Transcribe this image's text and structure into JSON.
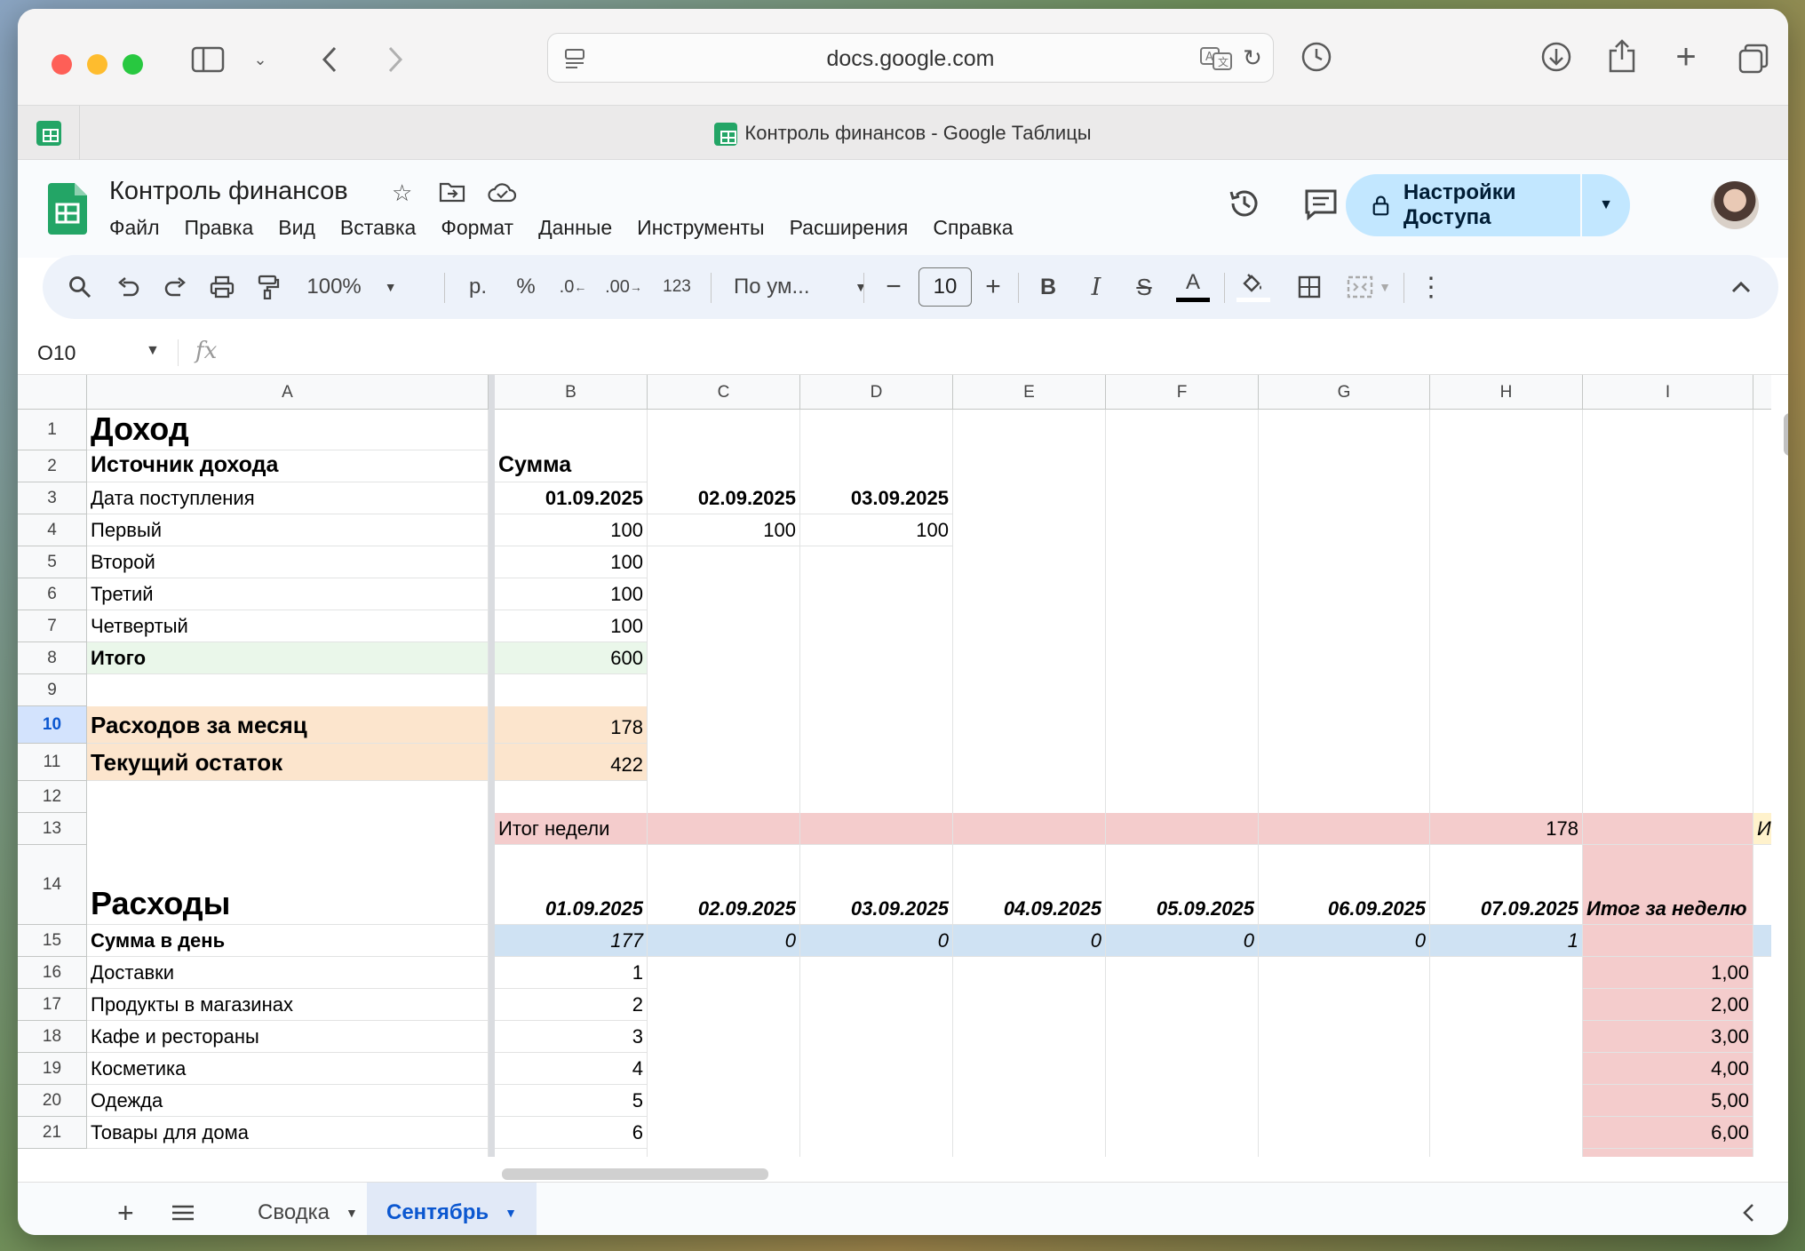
{
  "browser": {
    "url": "docs.google.com",
    "tab_title": "Контроль финансов - Google Таблицы"
  },
  "doc": {
    "title": "Контроль финансов",
    "menu": [
      "Файл",
      "Правка",
      "Вид",
      "Вставка",
      "Формат",
      "Данные",
      "Инструменты",
      "Расширения",
      "Справка"
    ],
    "share_label": "Настройки Доступа"
  },
  "toolbar": {
    "zoom": "100%",
    "currency": "р.",
    "percent": "%",
    "dec_decrease": ".0",
    "dec_increase": ".00",
    "number_format": "123",
    "font": "По ум...",
    "font_size": "10"
  },
  "formula": {
    "cell_ref": "O10",
    "fx": "fx"
  },
  "columns": [
    "A",
    "B",
    "C",
    "D",
    "E",
    "F",
    "G",
    "H",
    "I"
  ],
  "rows": [
    "1",
    "2",
    "3",
    "4",
    "5",
    "6",
    "7",
    "8",
    "9",
    "10",
    "11",
    "12",
    "13",
    "14",
    "15",
    "16",
    "17",
    "18",
    "19",
    "20",
    "21"
  ],
  "cells": {
    "A1": "Доход",
    "A2": "Источник дохода",
    "B2": "Сумма",
    "A3": "Дата поступления",
    "B3": "01.09.2025",
    "C3": "02.09.2025",
    "D3": "03.09.2025",
    "A4": "Первый",
    "B4": "100",
    "C4": "100",
    "D4": "100",
    "A5": "Второй",
    "B5": "100",
    "A6": "Третий",
    "B6": "100",
    "A7": "Четвертый",
    "B7": "100",
    "A8": "Итого",
    "B8": "600",
    "A10": "Расходов за месяц",
    "B10": "178",
    "A11": "Текущий остаток",
    "B11": "422",
    "B13": "Итог недели",
    "H13": "178",
    "J13": "Ито",
    "A14": "Расходы",
    "B14": "01.09.2025",
    "C14": "02.09.2025",
    "D14": "03.09.2025",
    "E14": "04.09.2025",
    "F14": "05.09.2025",
    "G14": "06.09.2025",
    "H14": "07.09.2025",
    "I14": "Итог за неделю",
    "A15": "Сумма в день",
    "B15": "177",
    "C15": "0",
    "D15": "0",
    "E15": "0",
    "F15": "0",
    "G15": "0",
    "H15": "1",
    "A16": "Доставки",
    "B16": "1",
    "I16": "1,00",
    "A17": "Продукты в магазинах",
    "B17": "2",
    "I17": "2,00",
    "A18": "Кафе и рестораны",
    "B18": "3",
    "I18": "3,00",
    "A19": "Косметика",
    "B19": "4",
    "I19": "4,00",
    "A20": "Одежда",
    "B20": "5",
    "I20": "5,00",
    "A21": "Товары для дома",
    "B21": "6",
    "I21": "6,00"
  },
  "sheets": [
    "Сводка",
    "Сентябрь"
  ],
  "active_sheet": "Сентябрь",
  "colors": {
    "orange_fill": "#fce5cd",
    "red_fill": "#f4cccc",
    "blue_fill": "#cfe2f3",
    "green_fill": "#eaf7ea",
    "share_button": "#c2e7ff",
    "sheets_green": "#23a566"
  }
}
